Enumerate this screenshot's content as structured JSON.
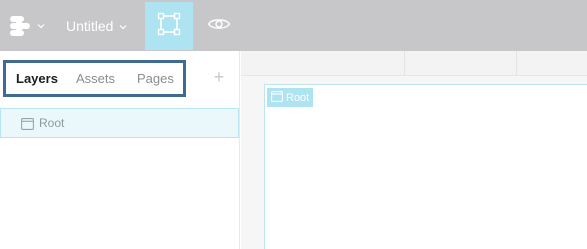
{
  "toolbar": {
    "project_title": "Untitled",
    "icons": {
      "logo": "app-logo-icon",
      "logo_caret": "chevron-down-icon",
      "title_caret": "chevron-down-icon",
      "frame_tool": "frame-tool-icon",
      "preview": "eye-icon"
    },
    "active_tool_color": "#aee3f1"
  },
  "sidebar": {
    "tabs": [
      {
        "label": "Layers",
        "active": true
      },
      {
        "label": "Assets",
        "active": false
      },
      {
        "label": "Pages",
        "active": false
      }
    ],
    "add_label": "+",
    "layers": [
      {
        "label": "Root",
        "icon": "frame-icon",
        "selected": true
      }
    ]
  },
  "canvas": {
    "board_label": "Root",
    "board_icon": "frame-icon",
    "highlight_color": "#aee3f1"
  }
}
